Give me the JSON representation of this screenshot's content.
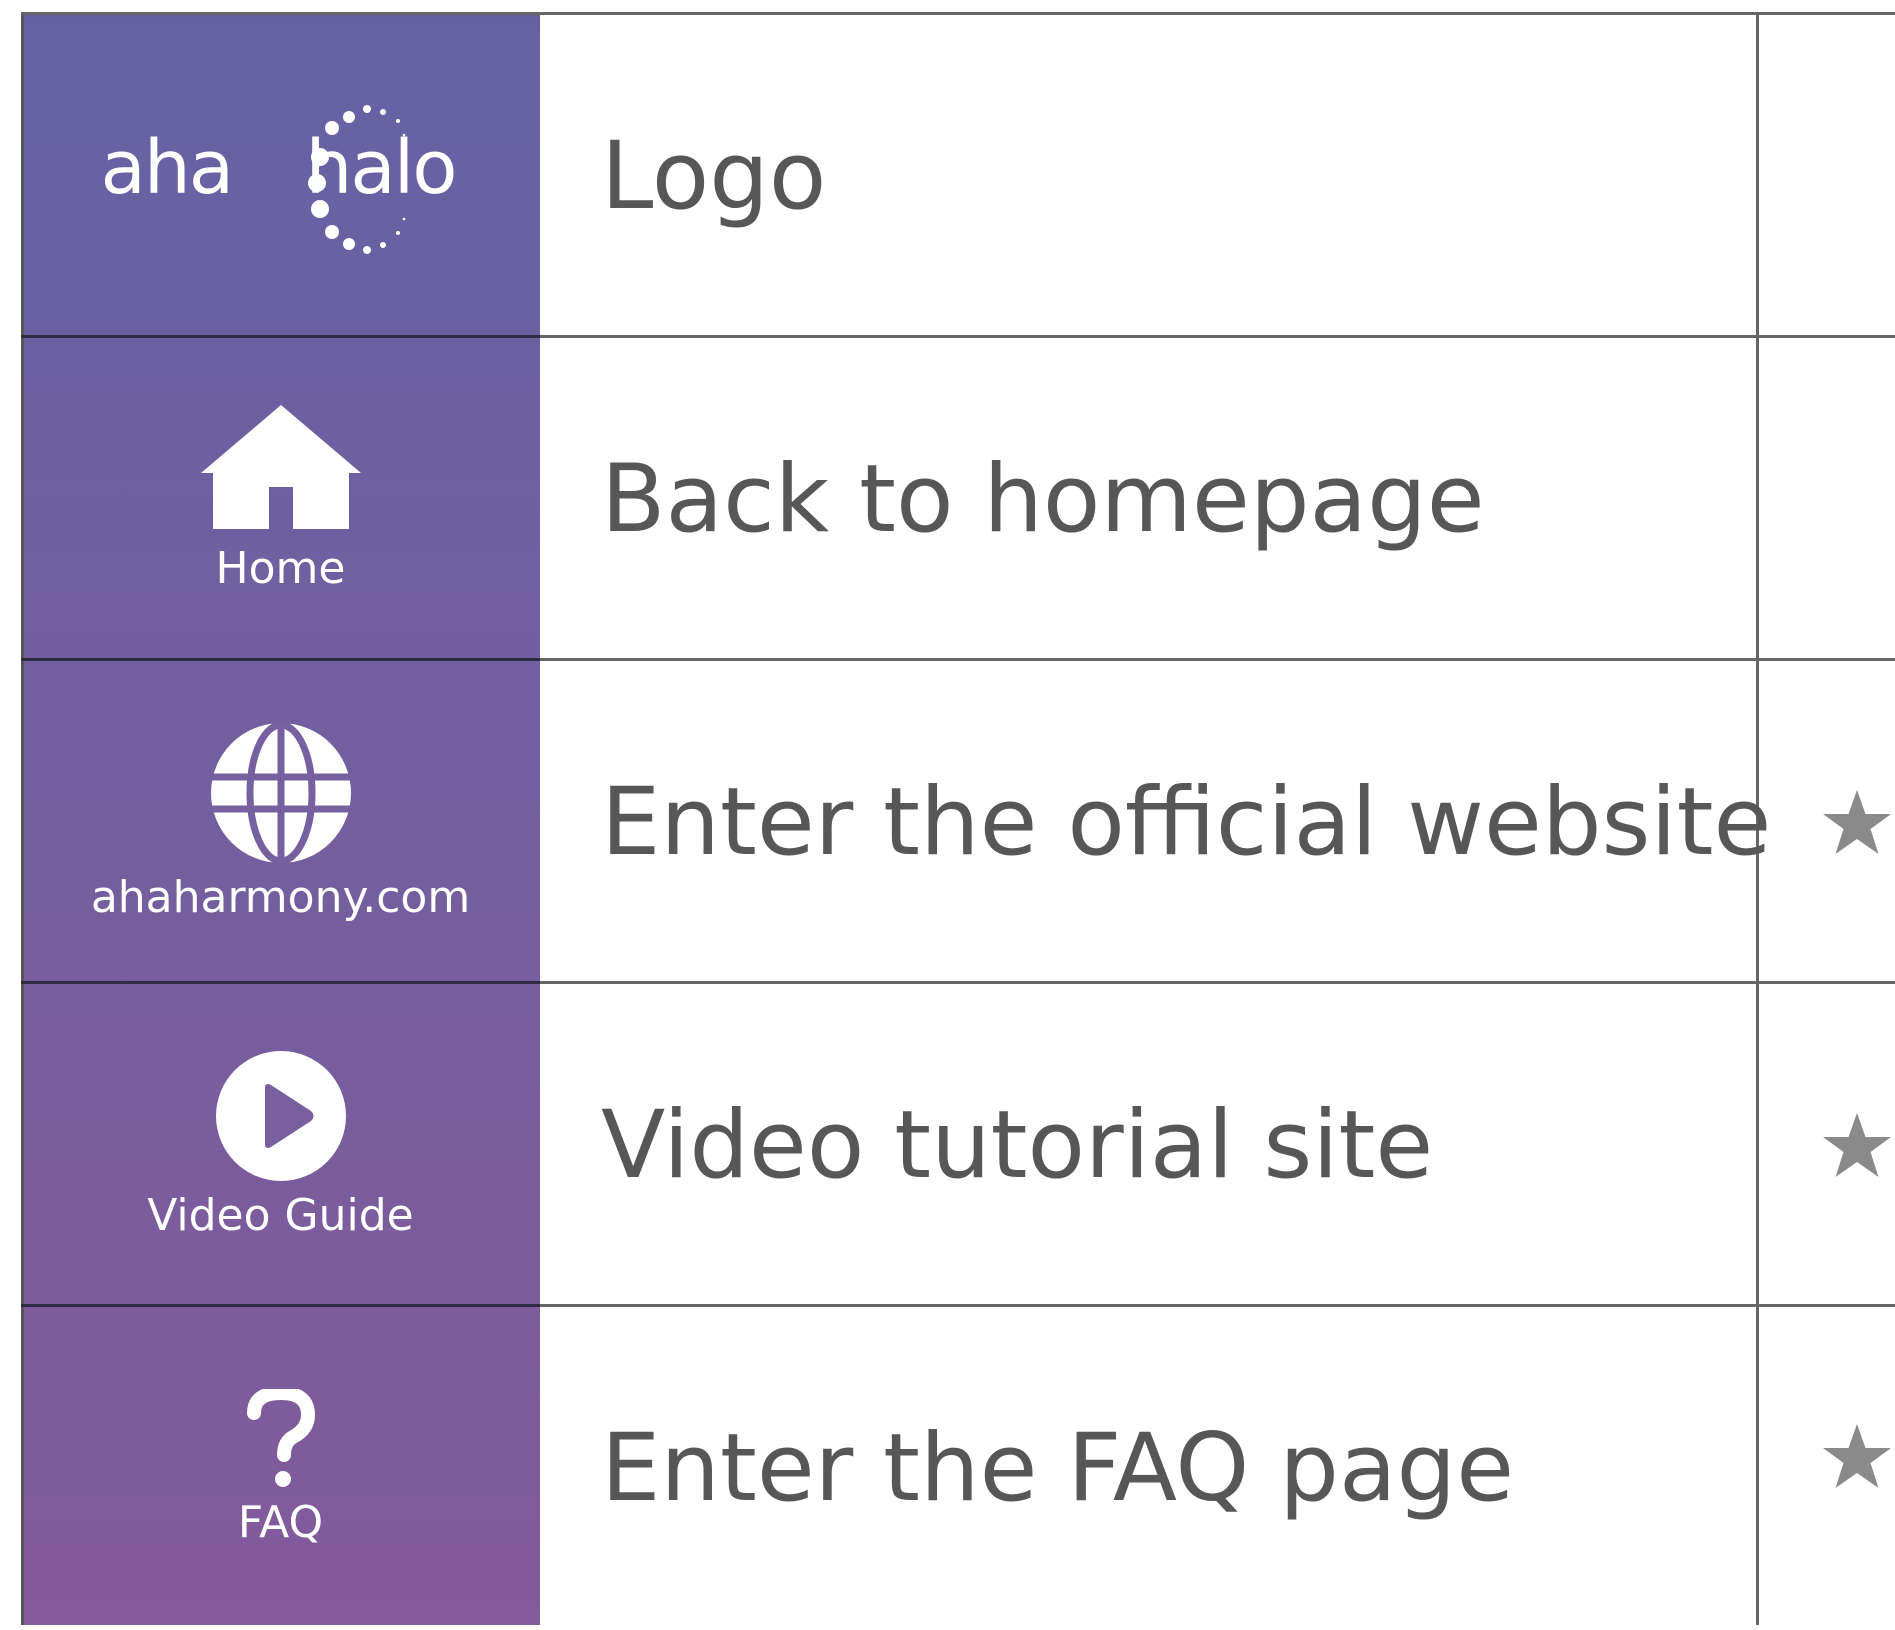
{
  "colors": {
    "sidebar_top": "#6562a4",
    "sidebar_bottom": "#835a9b",
    "label_text": "#575757",
    "star": "#8a8a8a"
  },
  "rows": [
    {
      "icon": "aha-halo-logo",
      "logo": {
        "left": "aha",
        "right": "halo"
      },
      "caption": "",
      "label": "Logo",
      "starred": false
    },
    {
      "icon": "home-icon",
      "caption": "Home",
      "label": "Back to homepage",
      "starred": false
    },
    {
      "icon": "globe-icon",
      "caption": "ahaharmony.com",
      "label": "Enter the official website",
      "starred": true
    },
    {
      "icon": "play-icon",
      "caption": "Video Guide",
      "label": "Video tutorial site",
      "starred": true
    },
    {
      "icon": "question-icon",
      "caption": "FAQ",
      "label": "Enter the FAQ page",
      "starred": true
    }
  ]
}
